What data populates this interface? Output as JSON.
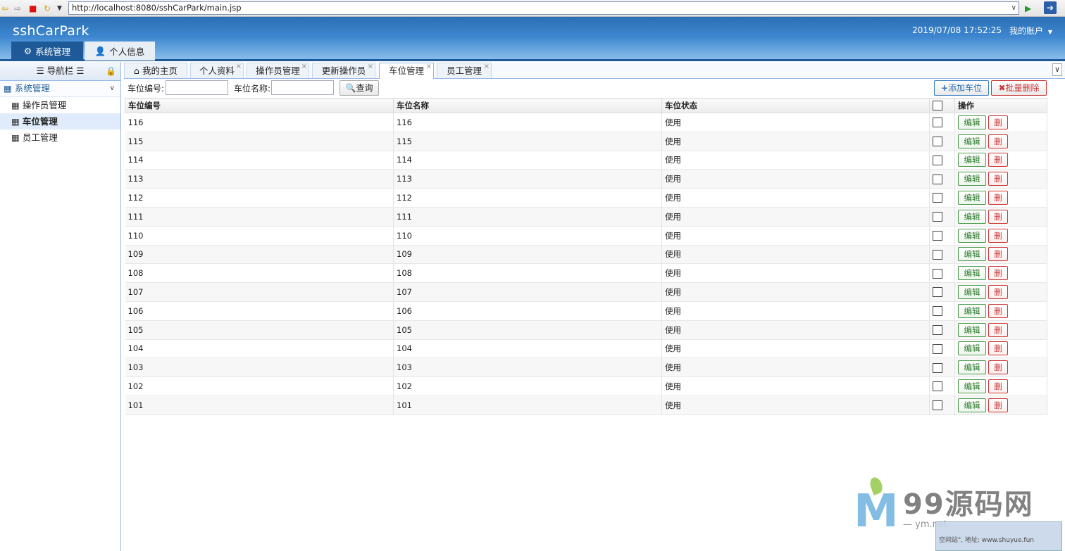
{
  "browser": {
    "url": "http://localhost:8080/sshCarPark/main.jsp"
  },
  "header": {
    "app_title": "sshCarPark",
    "datetime": "2019/07/08 17:52:25",
    "account_label": "我的账户",
    "top_tabs": [
      {
        "label": "系统管理",
        "icon": "gear-icon"
      },
      {
        "label": "个人信息",
        "icon": "user-icon"
      }
    ]
  },
  "sidebar": {
    "title": "导航栏",
    "group_label": "系统管理",
    "items": [
      {
        "label": "操作员管理"
      },
      {
        "label": "车位管理"
      },
      {
        "label": "员工管理"
      }
    ]
  },
  "tabs": [
    {
      "label": "我的主页"
    },
    {
      "label": "个人资料"
    },
    {
      "label": "操作员管理"
    },
    {
      "label": "更新操作员"
    },
    {
      "label": "车位管理"
    },
    {
      "label": "员工管理"
    }
  ],
  "toolbar": {
    "code_label": "车位编号:",
    "name_label": "车位名称:",
    "code_value": "",
    "name_value": "",
    "query_label": "查询",
    "add_label": "添加车位",
    "batch_delete_label": "批量删除"
  },
  "table": {
    "columns": [
      "车位编号",
      "车位名称",
      "车位状态",
      "",
      "操作"
    ],
    "edit_label": "编辑",
    "delete_label": "删",
    "rows": [
      {
        "code": "116",
        "name": "116",
        "status": "使用"
      },
      {
        "code": "115",
        "name": "115",
        "status": "使用"
      },
      {
        "code": "114",
        "name": "114",
        "status": "使用"
      },
      {
        "code": "113",
        "name": "113",
        "status": "使用"
      },
      {
        "code": "112",
        "name": "112",
        "status": "使用"
      },
      {
        "code": "111",
        "name": "111",
        "status": "使用"
      },
      {
        "code": "110",
        "name": "110",
        "status": "使用"
      },
      {
        "code": "109",
        "name": "109",
        "status": "使用"
      },
      {
        "code": "108",
        "name": "108",
        "status": "使用"
      },
      {
        "code": "107",
        "name": "107",
        "status": "使用"
      },
      {
        "code": "106",
        "name": "106",
        "status": "使用"
      },
      {
        "code": "105",
        "name": "105",
        "status": "使用"
      },
      {
        "code": "104",
        "name": "104",
        "status": "使用"
      },
      {
        "code": "103",
        "name": "103",
        "status": "使用"
      },
      {
        "code": "102",
        "name": "102",
        "status": "使用"
      },
      {
        "code": "101",
        "name": "101",
        "status": "使用"
      }
    ]
  },
  "watermark": {
    "logo_letter": "M",
    "brand": "99源码网",
    "sub": "— ym.net",
    "box_text": "空间站\", 地址: www.shuyue.fun"
  },
  "colors": {
    "header_dark": "#1e5a98",
    "accent_blue": "#2a6fb5",
    "edit_green": "#2a7a2a",
    "delete_red": "#cc3333"
  }
}
